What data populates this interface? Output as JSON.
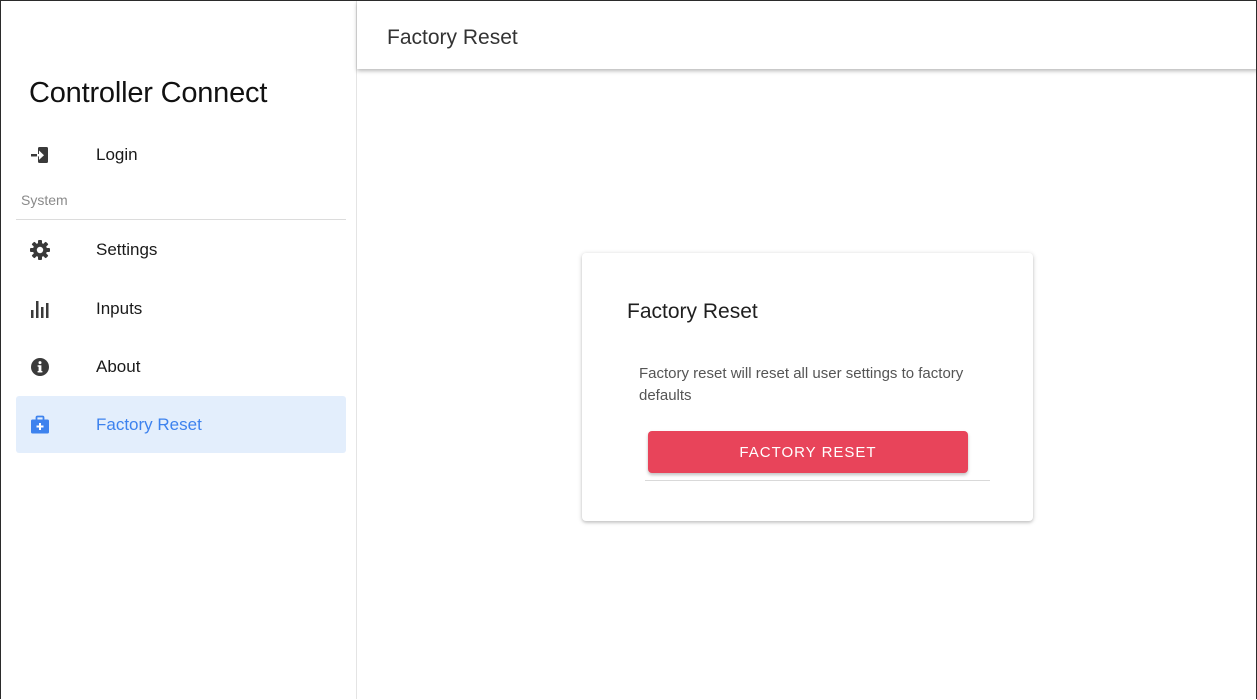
{
  "app": {
    "title": "Controller Connect"
  },
  "sidebar": {
    "top_items": [
      {
        "label": "Login",
        "icon": "login-icon"
      }
    ],
    "section_label": "System",
    "items": [
      {
        "label": "Settings",
        "icon": "gear-icon"
      },
      {
        "label": "Inputs",
        "icon": "bar-chart-icon"
      },
      {
        "label": "About",
        "icon": "info-icon"
      },
      {
        "label": "Factory Reset",
        "icon": "medical-kit-icon",
        "active": true
      }
    ]
  },
  "header": {
    "title": "Factory Reset"
  },
  "card": {
    "title": "Factory Reset",
    "description": "Factory reset will reset all user settings to factory defaults",
    "button_label": "FACTORY RESET"
  },
  "colors": {
    "accent": "#3d82ee",
    "active_bg": "#e3eefc",
    "danger": "#e8445a",
    "icon": "#3a3a3a"
  }
}
